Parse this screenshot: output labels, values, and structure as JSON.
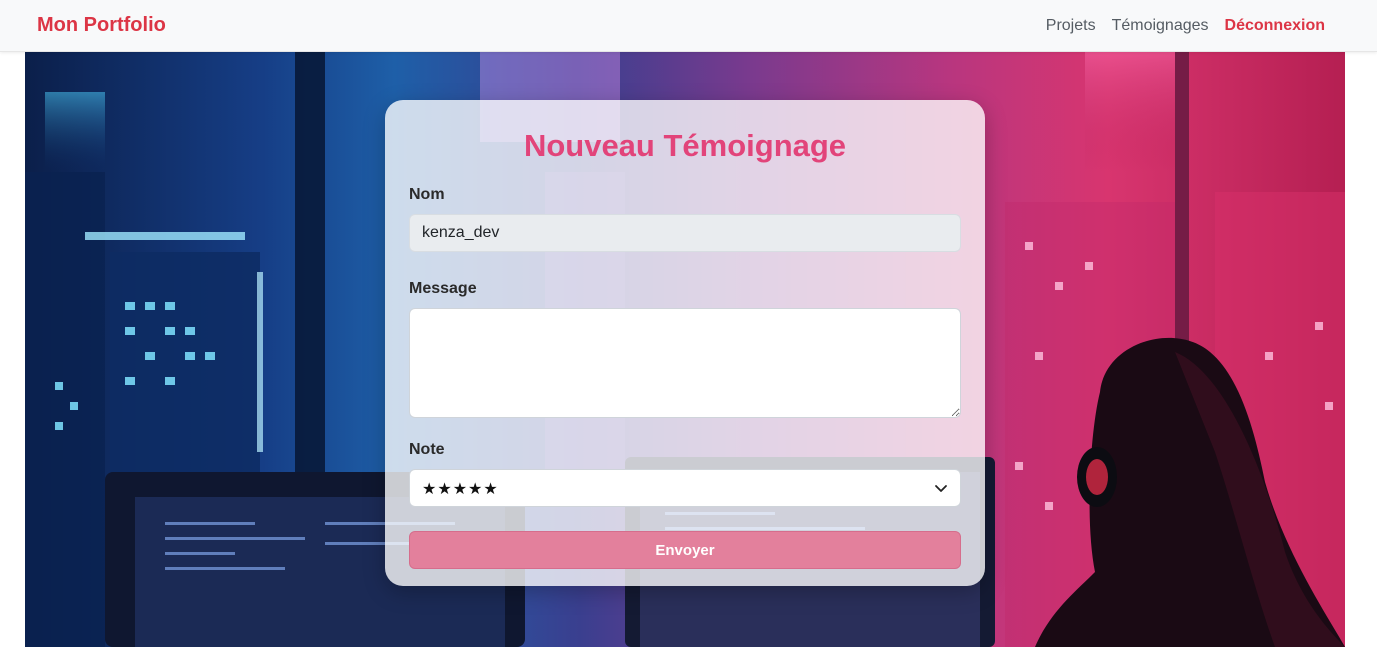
{
  "navbar": {
    "brand": "Mon Portfolio",
    "links": [
      {
        "label": "Projets"
      },
      {
        "label": "Témoignages"
      },
      {
        "label": "Déconnexion"
      }
    ]
  },
  "form": {
    "title": "Nouveau Témoignage",
    "name_label": "Nom",
    "name_value": "kenza_dev",
    "message_label": "Message",
    "message_value": "",
    "rating_label": "Note",
    "rating_value": "★★★★★",
    "submit_label": "Envoyer"
  },
  "colors": {
    "brand": "#dc3545",
    "title": "#e2447a",
    "button": "#e3809c"
  }
}
